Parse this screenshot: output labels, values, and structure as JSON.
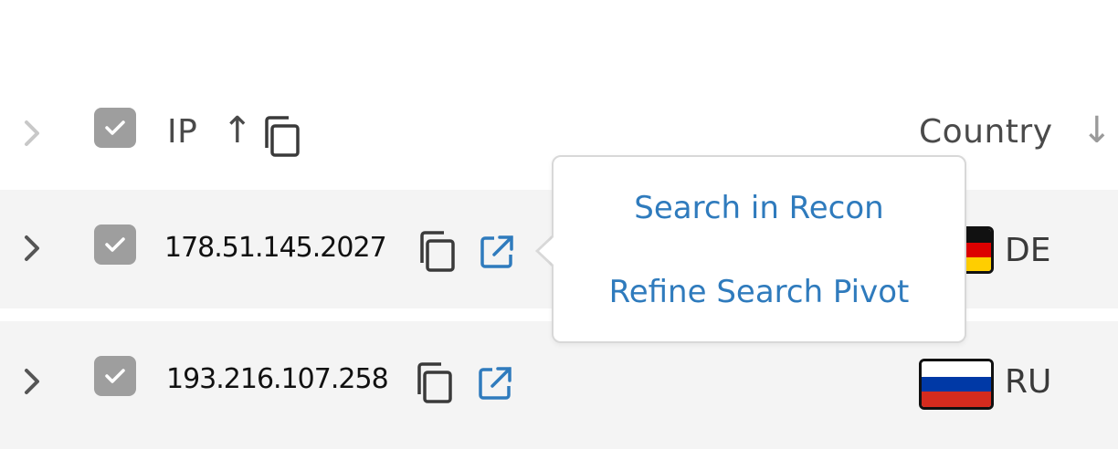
{
  "header": {
    "ip_label": "IP",
    "ip_sort": "↑",
    "country_label": "Country",
    "country_sort": "↓"
  },
  "rows": [
    {
      "ip": "178.51.145.2027",
      "country_code": "DE",
      "flag_colors": [
        "#111111",
        "#dd0000",
        "#ffce00"
      ]
    },
    {
      "ip": "193.216.107.258",
      "country_code": "RU",
      "flag_colors": [
        "#ffffff",
        "#0039a6",
        "#d52b1e"
      ]
    }
  ],
  "popup": {
    "items": [
      "Search in Recon",
      "Refine Search Pivot"
    ]
  },
  "colors": {
    "accent": "#2f7bbd",
    "checkbox": "#9e9e9e",
    "row_bg": "#f4f4f4"
  }
}
